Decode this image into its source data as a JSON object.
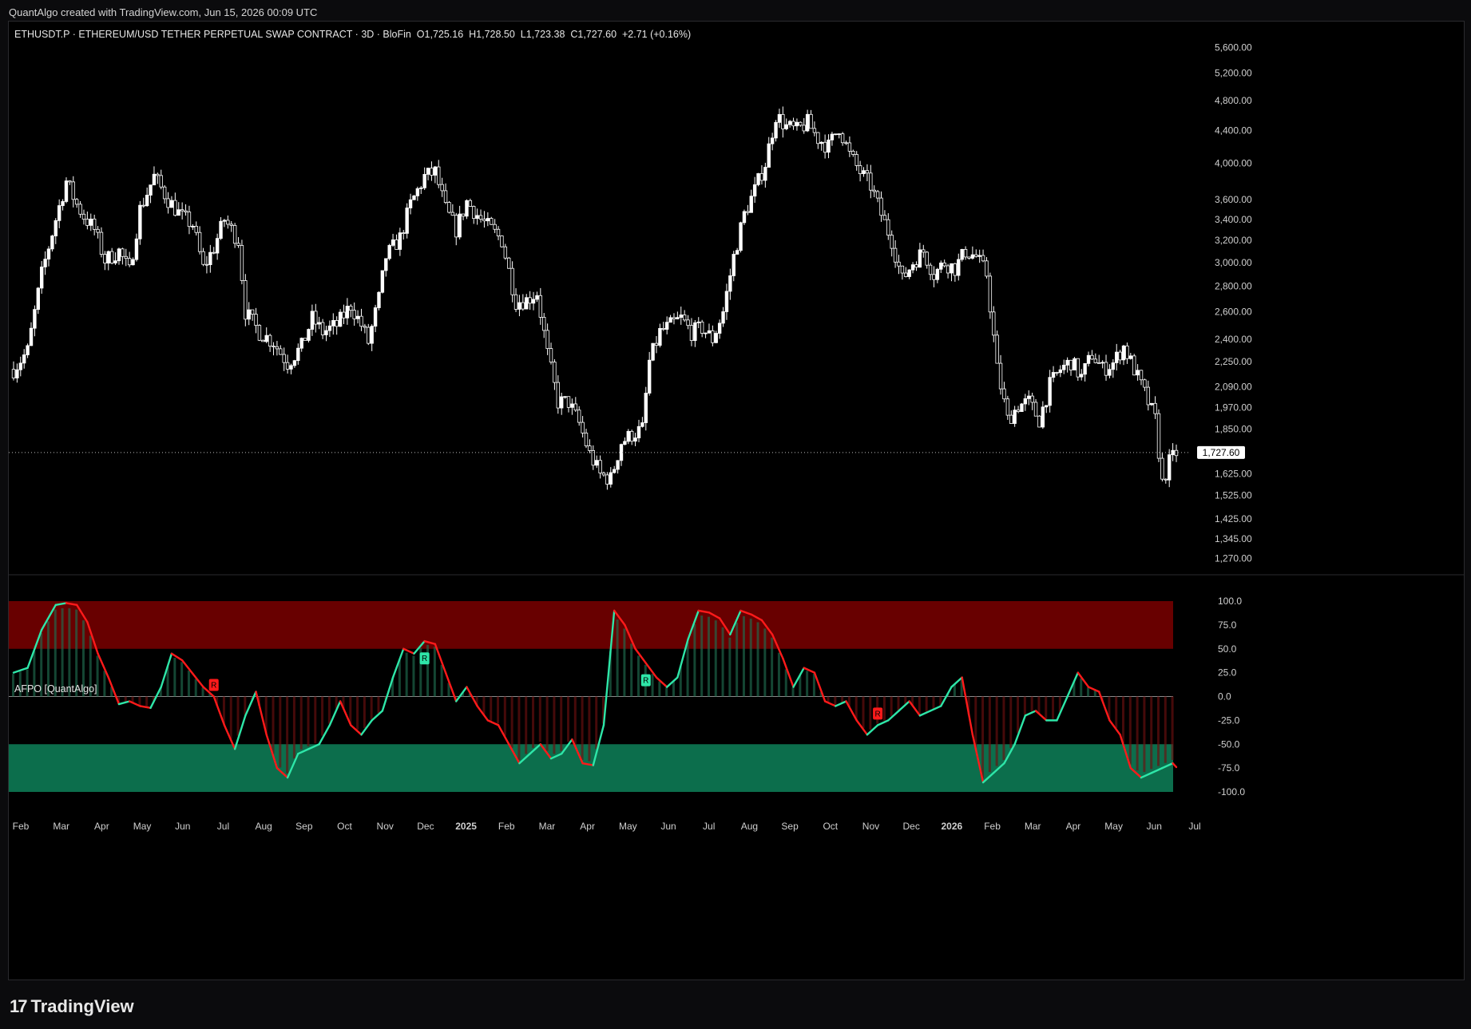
{
  "credit": "QuantAlgo created with TradingView.com, Jun 15, 2026 00:09 UTC",
  "legend": {
    "symbol": "ETHUSDT.P · ETHEREUM/USD TETHER PERPETUAL SWAP CONTRACT · 3D · BloFin",
    "o": "O1,725.16",
    "h": "H1,728.50",
    "l": "L1,723.38",
    "c": "C1,727.60",
    "chg": "+2.71 (+0.16%)"
  },
  "indicator_name": "AFPO [QuantAlgo]",
  "brand": "TradingView",
  "colors": {
    "background": "#000000",
    "candle": "#ffffff",
    "bull_line": "#2ee6a8",
    "bear_line": "#ff1a1a",
    "ob_zone": "#8b0000",
    "os_zone": "#0f8a5f"
  },
  "chart_data": [
    {
      "type": "candlestick",
      "price_scale": "log",
      "y_ticks": [
        "5,600.00",
        "5,200.00",
        "4,800.00",
        "4,400.00",
        "4,000.00",
        "3,600.00",
        "3,400.00",
        "3,200.00",
        "3,000.00",
        "2,800.00",
        "2,600.00",
        "2,400.00",
        "2,250.00",
        "2,090.00",
        "1,970.00",
        "1,850.00",
        "1,625.00",
        "1,525.00",
        "1,425.00",
        "1,345.00",
        "1,270.00"
      ],
      "last_price_label": "1,727.60",
      "last_price": 1727.6,
      "x_labels": [
        "Feb",
        "Mar",
        "Apr",
        "May",
        "Jun",
        "Jul",
        "Aug",
        "Sep",
        "Oct",
        "Nov",
        "Dec",
        "2025",
        "Feb",
        "Mar",
        "Apr",
        "May",
        "Jun",
        "Jul",
        "Aug",
        "Sep",
        "Oct",
        "Nov",
        "Dec",
        "2026",
        "Feb",
        "Mar",
        "Apr",
        "May",
        "Jun",
        "Jul"
      ],
      "close_path": [
        [
          0,
          2200
        ],
        [
          4,
          2320
        ],
        [
          8,
          2900
        ],
        [
          12,
          3400
        ],
        [
          15,
          3800
        ],
        [
          18,
          3550
        ],
        [
          20,
          3430
        ],
        [
          23,
          3300
        ],
        [
          26,
          3020
        ],
        [
          30,
          3100
        ],
        [
          33,
          2920
        ],
        [
          36,
          3500
        ],
        [
          40,
          3850
        ],
        [
          44,
          3600
        ],
        [
          48,
          3420
        ],
        [
          51,
          3350
        ],
        [
          54,
          2950
        ],
        [
          57,
          3130
        ],
        [
          60,
          3400
        ],
        [
          64,
          3200
        ],
        [
          66,
          2600
        ],
        [
          70,
          2450
        ],
        [
          74,
          2380
        ],
        [
          78,
          2240
        ],
        [
          82,
          2350
        ],
        [
          85,
          2550
        ],
        [
          88,
          2450
        ],
        [
          92,
          2500
        ],
        [
          96,
          2650
        ],
        [
          99,
          2500
        ],
        [
          101,
          2380
        ],
        [
          104,
          2700
        ],
        [
          106,
          3050
        ],
        [
          110,
          3220
        ],
        [
          113,
          3550
        ],
        [
          117,
          3850
        ],
        [
          120,
          3900
        ],
        [
          123,
          3500
        ],
        [
          126,
          3300
        ],
        [
          129,
          3580
        ],
        [
          133,
          3400
        ],
        [
          136,
          3300
        ],
        [
          139,
          3200
        ],
        [
          143,
          2680
        ],
        [
          146,
          2690
        ],
        [
          149,
          2750
        ],
        [
          152,
          2300
        ],
        [
          155,
          2000
        ],
        [
          158,
          2000
        ],
        [
          161,
          1880
        ],
        [
          164,
          1720
        ],
        [
          167,
          1620
        ],
        [
          170,
          1600
        ],
        [
          173,
          1780
        ],
        [
          176,
          1820
        ],
        [
          179,
          1850
        ],
        [
          181,
          2250
        ],
        [
          184,
          2450
        ],
        [
          187,
          2500
        ],
        [
          190,
          2550
        ],
        [
          193,
          2450
        ],
        [
          196,
          2480
        ],
        [
          199,
          2400
        ],
        [
          202,
          2600
        ],
        [
          205,
          3050
        ],
        [
          208,
          3450
        ],
        [
          211,
          3700
        ],
        [
          214,
          4000
        ],
        [
          217,
          4600
        ],
        [
          220,
          4450
        ],
        [
          223,
          4400
        ],
        [
          226,
          4500
        ],
        [
          229,
          4300
        ],
        [
          232,
          4200
        ],
        [
          235,
          4450
        ],
        [
          238,
          4100
        ],
        [
          241,
          3900
        ],
        [
          244,
          3750
        ],
        [
          247,
          3450
        ],
        [
          250,
          3200
        ],
        [
          253,
          2850
        ],
        [
          256,
          3000
        ],
        [
          259,
          3100
        ],
        [
          262,
          2900
        ],
        [
          265,
          3000
        ],
        [
          268,
          2950
        ],
        [
          271,
          3100
        ],
        [
          274,
          3050
        ],
        [
          277,
          2900
        ],
        [
          280,
          2200
        ],
        [
          283,
          1900
        ],
        [
          286,
          1980
        ],
        [
          289,
          2000
        ],
        [
          292,
          1900
        ],
        [
          295,
          2100
        ],
        [
          298,
          2200
        ],
        [
          301,
          2250
        ],
        [
          304,
          2150
        ],
        [
          307,
          2300
        ],
        [
          310,
          2200
        ],
        [
          313,
          2240
        ],
        [
          316,
          2350
        ],
        [
          319,
          2200
        ],
        [
          322,
          2050
        ],
        [
          325,
          1900
        ],
        [
          327,
          1580
        ],
        [
          329,
          1680
        ],
        [
          331,
          1727
        ]
      ],
      "x_unit": "bar index (3D bars)"
    },
    {
      "type": "line",
      "name": "AFPO [QuantAlgo]",
      "y_ticks": [
        "100.0",
        "75.0",
        "50.0",
        "25.0",
        "0.0",
        "-25.0",
        "-50.0",
        "-75.0",
        "-100.0"
      ],
      "ylim": [
        -100,
        100
      ],
      "x": [
        0,
        4,
        8,
        12,
        15,
        18,
        21,
        24,
        27,
        30,
        33,
        36,
        39,
        42,
        45,
        48,
        51,
        54,
        57,
        60,
        63,
        66,
        69,
        72,
        75,
        78,
        81,
        84,
        87,
        90,
        93,
        96,
        99,
        102,
        105,
        108,
        111,
        114,
        117,
        120,
        123,
        126,
        129,
        132,
        135,
        138,
        141,
        144,
        147,
        150,
        153,
        156,
        159,
        162,
        165,
        168,
        171,
        174,
        177,
        180,
        183,
        186,
        189,
        192,
        195,
        198,
        201,
        204,
        207,
        210,
        213,
        216,
        219,
        222,
        225,
        228,
        231,
        234,
        237,
        240,
        243,
        246,
        249,
        252,
        255,
        258,
        261,
        264,
        267,
        270,
        273,
        276,
        279,
        282,
        285,
        288,
        291,
        294,
        297,
        300,
        303,
        306,
        309,
        312,
        315,
        318,
        321,
        324,
        327,
        330,
        331
      ],
      "values": [
        25,
        30,
        70,
        96,
        98,
        96,
        78,
        45,
        20,
        -8,
        -5,
        -10,
        -12,
        10,
        45,
        38,
        24,
        10,
        0,
        -30,
        -55,
        -20,
        5,
        -40,
        -75,
        -85,
        -60,
        -55,
        -50,
        -30,
        -5,
        -30,
        -40,
        -25,
        -15,
        20,
        50,
        45,
        58,
        55,
        25,
        -5,
        10,
        -10,
        -25,
        -30,
        -50,
        -70,
        -60,
        -50,
        -65,
        -60,
        -45,
        -70,
        -72,
        -30,
        90,
        75,
        50,
        35,
        20,
        10,
        20,
        60,
        90,
        88,
        82,
        65,
        90,
        86,
        80,
        65,
        40,
        10,
        30,
        25,
        -5,
        -10,
        -5,
        -25,
        -40,
        -30,
        -25,
        -15,
        -5,
        -20,
        -15,
        -10,
        10,
        20,
        -40,
        -90,
        -80,
        -70,
        -50,
        -20,
        -15,
        -25,
        -25,
        0,
        25,
        10,
        5,
        -25,
        -40,
        -75,
        -85,
        -80,
        -75,
        -70,
        -74
      ],
      "reference_lines": [
        0,
        50,
        -50
      ],
      "ob_zone": [
        50,
        100
      ],
      "os_zone": [
        -100,
        -50
      ],
      "markers": [
        {
          "x": 57,
          "label": "R",
          "type": "bear"
        },
        {
          "x": 117,
          "label": "R",
          "type": "bull"
        },
        {
          "x": 180,
          "label": "R",
          "type": "bull"
        },
        {
          "x": 246,
          "label": "R",
          "type": "bear"
        }
      ]
    }
  ]
}
